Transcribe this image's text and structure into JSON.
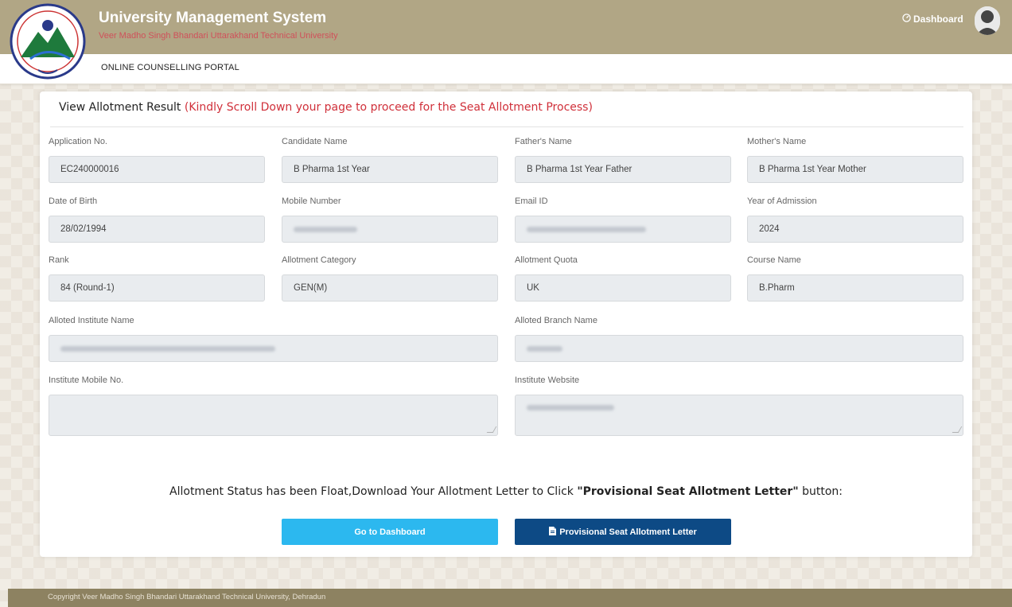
{
  "header": {
    "title": "University Management System",
    "subtitle": "Veer Madho Singh Bhandari Uttarakhand Technical University",
    "dashboard_link": "Dashboard",
    "portal_label": "ONLINE COUNSELLING PORTAL"
  },
  "card": {
    "title": "View Allotment Result",
    "title_note": "(Kindly Scroll Down your page to proceed for the Seat Allotment Process)"
  },
  "fields": {
    "application_no": {
      "label": "Application No.",
      "value": "EC240000016"
    },
    "candidate_name": {
      "label": "Candidate Name",
      "value": "B Pharma 1st Year"
    },
    "father_name": {
      "label": "Father's Name",
      "value": "B Pharma 1st Year Father"
    },
    "mother_name": {
      "label": "Mother's Name",
      "value": "B Pharma 1st Year Mother"
    },
    "dob": {
      "label": "Date of Birth",
      "value": "28/02/1994"
    },
    "mobile": {
      "label": "Mobile Number"
    },
    "email": {
      "label": "Email ID"
    },
    "year_of_admission": {
      "label": "Year of Admission",
      "value": "2024"
    },
    "rank": {
      "label": "Rank",
      "value": "84 (Round-1)"
    },
    "allotment_category": {
      "label": "Allotment Category",
      "value": "GEN(M)"
    },
    "allotment_quota": {
      "label": "Allotment Quota",
      "value": "UK"
    },
    "course_name": {
      "label": "Course Name",
      "value": "B.Pharm"
    },
    "institute_name": {
      "label": "Alloted Institute Name"
    },
    "branch_name": {
      "label": "Alloted Branch Name"
    },
    "institute_mobile": {
      "label": "Institute Mobile No."
    },
    "institute_website": {
      "label": "Institute Website"
    }
  },
  "status": {
    "prefix": "Allotment Status has been Float,Download Your Allotment Letter to Click ",
    "highlight": "\"Provisional Seat Allotment Letter\"",
    "suffix": " button:"
  },
  "buttons": {
    "dashboard": "Go to Dashboard",
    "letter": "Provisional Seat Allotment Letter"
  },
  "footer": {
    "copyright": "Copyright Veer Madho Singh Bhandari Uttarakhand Technical University, Dehradun"
  },
  "colors": {
    "header_bg": "#b1a685",
    "accent_red": "#d0303a",
    "primary_light": "#2cb8ef",
    "primary_dark": "#0d4a85",
    "footer_bg": "#8d8261"
  },
  "icons": {
    "logo": "university-emblem",
    "dashboard": "gauge-icon",
    "avatar": "user-avatar-icon",
    "letter": "document-icon"
  }
}
